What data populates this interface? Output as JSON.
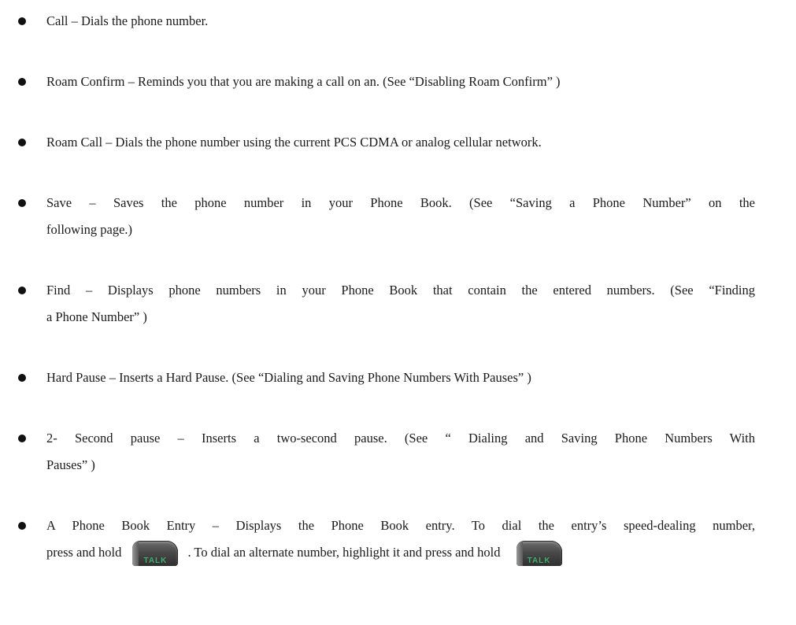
{
  "items": [
    {
      "lines": [
        "Call – Dials the phone number."
      ]
    },
    {
      "lines": [
        "Roam Confirm – Reminds you that you are making a call on an. (See “Disabling Roam Confirm” )"
      ]
    },
    {
      "lines": [
        "Roam Call – Dials the phone number using the current PCS CDMA or analog cellular network."
      ]
    },
    {
      "lines": [
        "Save – Saves the phone number in your Phone Book. (See “Saving a Phone Number” on the",
        "following page.)"
      ]
    },
    {
      "lines": [
        "Find – Displays phone numbers in your Phone Book that contain the entered numbers. (See “Finding",
        "a Phone Number” )"
      ]
    },
    {
      "lines": [
        "Hard Pause – Inserts a Hard Pause. (See “Dialing and Saving Phone Numbers With Pauses” )"
      ]
    },
    {
      "lines": [
        "2- Second pause – Inserts a two-second pause. (See “ Dialing and Saving Phone Numbers With",
        "Pauses” )"
      ]
    },
    {
      "line1": "A Phone Book Entry – Displays the Phone Book entry. To dial the entry’s speed-dealing number,",
      "line2_before": "press and hold",
      "line2_middle": ". To dial an alternate number, highlight it and press and hold",
      "key_label": "TALK",
      "key_icon": "talk-key-icon"
    }
  ]
}
